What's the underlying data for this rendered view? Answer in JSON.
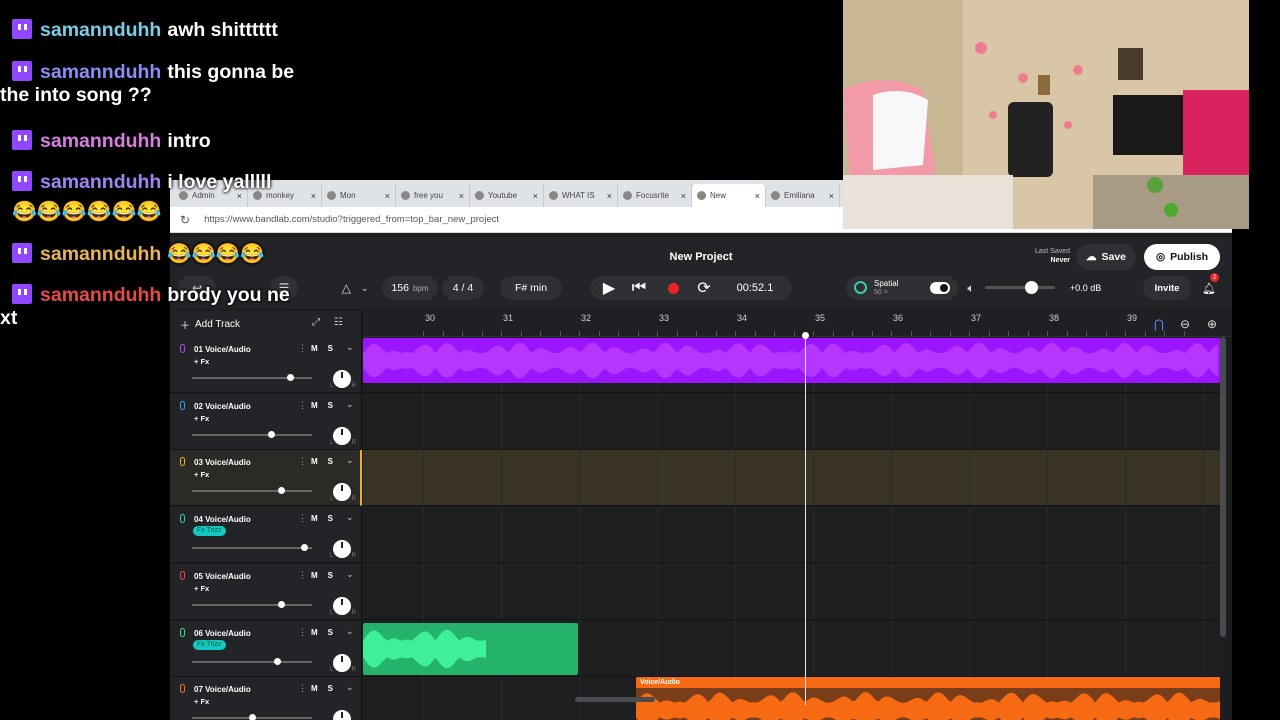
{
  "chat": {
    "messages": [
      {
        "user": "samannduhh",
        "text": "awh shitttttt",
        "color": "#7ccde8"
      },
      {
        "user": "samannduhh",
        "text": "this gonna be",
        "text2": "the into song ??",
        "color": "#8a8ef5"
      },
      {
        "user": "samannduhh",
        "text": "intro",
        "color": "#d77fe0"
      },
      {
        "user": "samannduhh",
        "text": "i love yalllll",
        "color": "#a084f2"
      },
      {
        "user": "samannduhh",
        "text": "😂😂😂😂",
        "color": "#e7b45a"
      },
      {
        "user": "samannduhh",
        "text": "brody you ne",
        "text2": "xt",
        "color": "#e84a4a"
      }
    ],
    "emoji_line": "😂😂😂😂😂😂"
  },
  "browser": {
    "tabs": [
      {
        "label": "Admin"
      },
      {
        "label": "monkey"
      },
      {
        "label": "Mon"
      },
      {
        "label": "free you"
      },
      {
        "label": "Youtube"
      },
      {
        "label": "WHAT IS"
      },
      {
        "label": "Focusrite"
      },
      {
        "label": "New"
      },
      {
        "label": "Emiliana"
      }
    ],
    "url": "https://www.bandlab.com/studio?triggered_from=top_bar_new_project"
  },
  "daw": {
    "project_title": "New Project",
    "last_saved_label": "Last Saved",
    "last_saved_value": "Never",
    "save_label": "Save",
    "publish_label": "Publish",
    "bpm_value": "156",
    "bpm_unit": "bpm",
    "time_signature": "4 / 4",
    "key": "F# min",
    "time": "00:52.1",
    "spatial_label": "Spatial",
    "spatial_value": "50 >",
    "master_db": "+0.0 dB",
    "invite_label": "Invite",
    "notification_count": "2",
    "add_track_label": "Add Track",
    "ruler_bars": [
      "30",
      "31",
      "32",
      "33",
      "34",
      "35",
      "36",
      "37",
      "38",
      "39"
    ],
    "tracks": [
      {
        "num": "01",
        "name": "Voice/Audio",
        "fx": "+ Fx",
        "color": "#b040ff",
        "volume": 0.82
      },
      {
        "num": "02",
        "name": "Voice/Audio",
        "fx": "+ Fx",
        "color": "#3d9cf0",
        "volume": 0.66
      },
      {
        "num": "03",
        "name": "Voice/Audio",
        "fx": "+ Fx",
        "color": "#f0b020",
        "volume": 0.74,
        "selected": true
      },
      {
        "num": "04",
        "name": "Voice/Audio",
        "fx_preset": "Fx Trizz",
        "color": "#3dc6b0",
        "volume": 0.93
      },
      {
        "num": "05",
        "name": "Voice/Audio",
        "fx": "+ Fx",
        "color": "#e84a4a",
        "volume": 0.74
      },
      {
        "num": "06",
        "name": "Voice/Audio",
        "fx_preset": "Fx Trizz",
        "color": "#3ad98a",
        "volume": 0.71
      },
      {
        "num": "07",
        "name": "Voice/Audio",
        "fx": "+ Fx",
        "color": "#f07020",
        "volume": 0.5
      }
    ],
    "clip_label": "Voice/Audio",
    "colors": {
      "accent": "#e8262a",
      "purple_clip": "#9b15ff",
      "green_clip": "#25b26a",
      "orange_clip": "#f56a12"
    }
  },
  "icons": [
    "twitch-icon",
    "reload-icon",
    "play-icon",
    "skip-back-icon",
    "record-icon",
    "loop-icon",
    "volume-icon",
    "bell-icon",
    "cloud-upload-icon",
    "globe-icon",
    "metronome-icon",
    "magnet-icon",
    "zoom-out-icon",
    "zoom-in-icon",
    "plus-icon",
    "mic-icon"
  ]
}
